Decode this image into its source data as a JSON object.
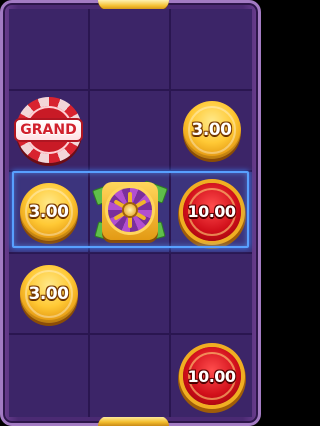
{
  "board": {
    "rows": 5,
    "cols": 3,
    "highlighted_row": 3
  },
  "symbols": {
    "grand_label": "GRAND",
    "coin_r2c3": "3.00",
    "coin_r3c1": "3.00",
    "coin_r3c3": "10.00",
    "coin_r4c1": "3.00",
    "coin_r5c3": "10.00"
  },
  "colors": {
    "frame": "#4b2a73",
    "grid": "#3c2568",
    "highlight": "#58a0ff",
    "gold": "#ffc935",
    "red": "#d10f1a"
  }
}
